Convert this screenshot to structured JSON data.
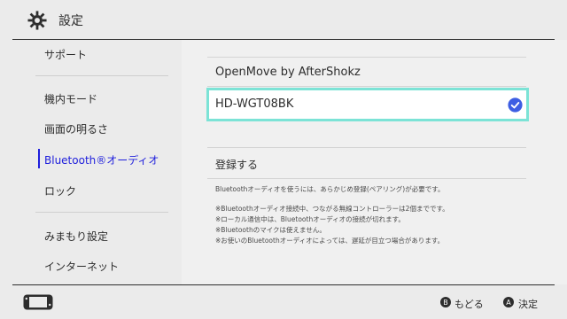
{
  "header": {
    "title": "設定",
    "icon": "gear-icon"
  },
  "sidebar": {
    "items": [
      {
        "label": "サポート"
      },
      {
        "label": "機内モード"
      },
      {
        "label": "画面の明るさ"
      },
      {
        "label": "Bluetooth®オーディオ",
        "active": true
      },
      {
        "label": "ロック"
      },
      {
        "label": "みまもり設定"
      },
      {
        "label": "インターネット"
      }
    ]
  },
  "main": {
    "devices": [
      {
        "name": "OpenMove by AfterShokz",
        "selected": false
      },
      {
        "name": "HD-WGT08BK",
        "selected": true
      }
    ],
    "register_label": "登録する",
    "notes": [
      "Bluetoothオーディオを使うには、あらかじめ登録(ペアリング)が必要です。",
      "※Bluetoothオーディオ接続中、つながる無線コントローラーは2個までです。",
      "※ローカル通信中は、Bluetoothオーディオの接続が切れます。",
      "※Bluetoothのマイクは使えません。",
      "※お使いのBluetoothオーディオによっては、遅延が目立つ場合があります。"
    ]
  },
  "footer": {
    "back": {
      "button": "B",
      "label": "もどる"
    },
    "ok": {
      "button": "A",
      "label": "決定"
    }
  },
  "colors": {
    "accent": "#1e1edc",
    "selection_border": "#7ce3d6",
    "check": "#3d5ee3"
  }
}
